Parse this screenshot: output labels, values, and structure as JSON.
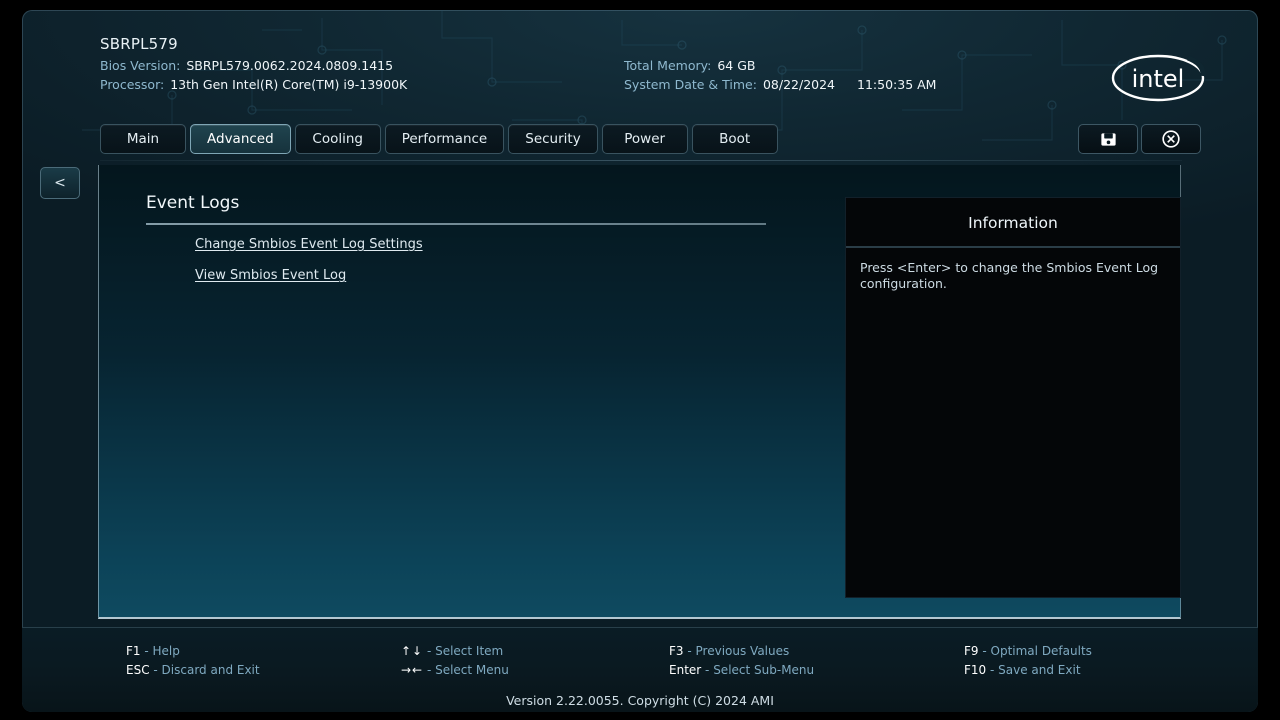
{
  "header": {
    "system_title": "SBRPL579",
    "fields": [
      {
        "label": "Bios Version:",
        "value": "SBRPL579.0062.2024.0809.1415"
      },
      {
        "label": "Processor:",
        "value": "13th Gen Intel(R) Core(TM) i9-13900K"
      },
      {
        "label": "Total Memory:",
        "value": "64 GB"
      },
      {
        "label": "System Date & Time:",
        "value": "08/22/2024",
        "value2": "11:50:35 AM"
      }
    ],
    "logo_text": "intel",
    "logo_name": "intel-logo"
  },
  "tabs": [
    {
      "label": "Main",
      "active": false
    },
    {
      "label": "Advanced",
      "active": true
    },
    {
      "label": "Cooling",
      "active": false
    },
    {
      "label": "Performance",
      "active": false
    },
    {
      "label": "Security",
      "active": false
    },
    {
      "label": "Power",
      "active": false
    },
    {
      "label": "Boot",
      "active": false
    }
  ],
  "top_actions": [
    {
      "name": "save-button",
      "icon": "floppy-disk-icon"
    },
    {
      "name": "exit-button",
      "icon": "close-circle-icon"
    }
  ],
  "back_button": {
    "label": "<",
    "icon": "chevron-left-icon"
  },
  "main": {
    "page_title": "Event Logs",
    "menu_items": [
      {
        "label": "Change Smbios Event Log Settings"
      },
      {
        "label": "View Smbios Event Log"
      }
    ]
  },
  "info": {
    "title": "Information",
    "text": "Press <Enter> to change the Smbios Event Log configuration."
  },
  "footer": {
    "help": [
      {
        "key": "F1",
        "desc": "- Help"
      },
      {
        "key": "↑↓",
        "desc": "- Select Item"
      },
      {
        "key": "F3",
        "desc": "- Previous Values"
      },
      {
        "key": "F9",
        "desc": "- Optimal Defaults"
      },
      {
        "key": "ESC",
        "desc": "- Discard and Exit"
      },
      {
        "key": "→←",
        "desc": "- Select Menu"
      },
      {
        "key": "Enter",
        "desc": "- Select Sub-Menu"
      },
      {
        "key": "F10",
        "desc": "- Save and Exit"
      }
    ],
    "version": "Version 2.22.0055. Copyright (C) 2024 AMI"
  },
  "colors": {
    "accent": "#0e4a60",
    "panel_dark": "#040608",
    "text_primary": "#f0f6f9",
    "text_muted": "#8fb9cf",
    "footer_desc": "#7fa9c0"
  }
}
